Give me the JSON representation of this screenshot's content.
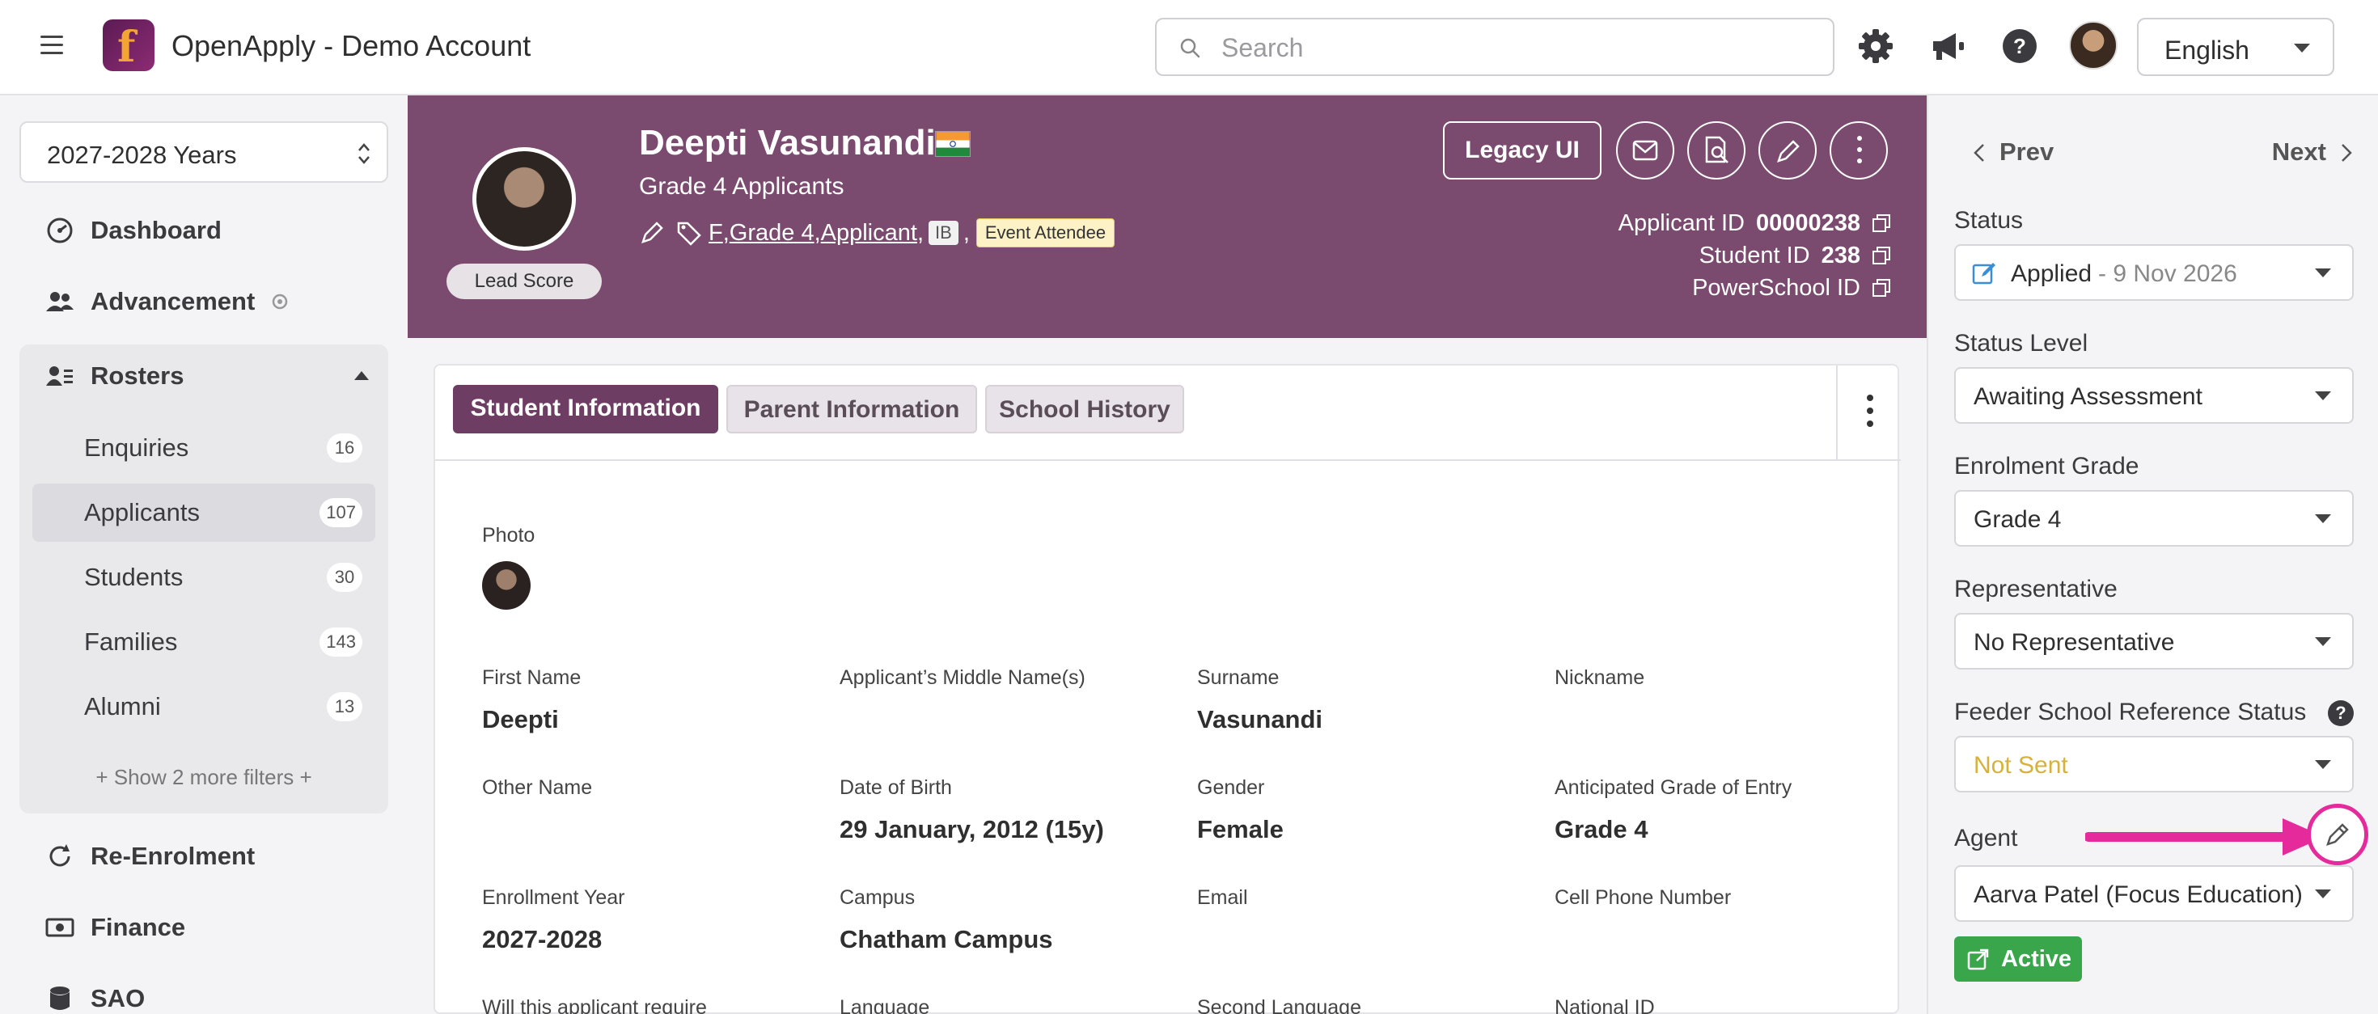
{
  "app": {
    "title": "OpenApply - Demo Account"
  },
  "search": {
    "placeholder": "Search"
  },
  "language": {
    "selected": "English"
  },
  "sidebar": {
    "year": "2027-2028 Years",
    "items": [
      {
        "label": "Dashboard",
        "icon": "dashboard-icon"
      },
      {
        "label": "Advancement",
        "icon": "users-icon"
      },
      {
        "label": "Rosters",
        "icon": "roster-icon"
      },
      {
        "label": "Re-Enrolment",
        "icon": "refresh-icon"
      },
      {
        "label": "Finance",
        "icon": "cash-icon"
      },
      {
        "label": "SAO",
        "icon": "database-icon"
      }
    ],
    "rosters": [
      {
        "label": "Enquiries",
        "count": "16"
      },
      {
        "label": "Applicants",
        "count": "107"
      },
      {
        "label": "Students",
        "count": "30"
      },
      {
        "label": "Families",
        "count": "143"
      },
      {
        "label": "Alumni",
        "count": "13"
      }
    ],
    "more_filters": "+ Show 2 more filters +"
  },
  "applicant": {
    "name": "Deepti Vasunandi",
    "subtitle": "Grade 4 Applicants",
    "lead_score": "Lead Score",
    "tags": {
      "f": "F",
      "grade": "Grade 4",
      "type": "Applicant",
      "ib": "IB",
      "event": "Event Attendee"
    },
    "applicant_id_label": "Applicant ID",
    "applicant_id": "00000238",
    "student_id_label": "Student ID",
    "student_id": "238",
    "powerschool_label": "PowerSchool ID",
    "legacy_label": "Legacy UI"
  },
  "tabs": [
    "Student Information",
    "Parent Information",
    "School History"
  ],
  "fields": {
    "photo": "Photo",
    "first_name": {
      "label": "First Name",
      "value": "Deepti"
    },
    "middle_name": {
      "label": "Applicant’s Middle Name(s)",
      "value": ""
    },
    "surname": {
      "label": "Surname",
      "value": "Vasunandi"
    },
    "nickname": {
      "label": "Nickname",
      "value": ""
    },
    "other_name": {
      "label": "Other Name",
      "value": ""
    },
    "dob": {
      "label": "Date of Birth",
      "value": "29 January, 2012 (15y)"
    },
    "gender": {
      "label": "Gender",
      "value": "Female"
    },
    "anticipated_grade": {
      "label": "Anticipated Grade of Entry",
      "value": "Grade 4"
    },
    "enrollment_year": {
      "label": "Enrollment Year",
      "value": "2027-2028"
    },
    "campus": {
      "label": "Campus",
      "value": "Chatham Campus"
    },
    "email": {
      "label": "Email",
      "value": ""
    },
    "cell_phone": {
      "label": "Cell Phone Number",
      "value": ""
    },
    "require": {
      "label": "Will this applicant require"
    },
    "language": {
      "label": "Language"
    },
    "second_language": {
      "label": "Second Language"
    },
    "national_id": {
      "label": "National ID"
    }
  },
  "panel": {
    "prev": "Prev",
    "next": "Next",
    "status": {
      "label": "Status",
      "value": "Applied",
      "date": " - 9 Nov 2026"
    },
    "status_level": {
      "label": "Status Level",
      "value": "Awaiting Assessment"
    },
    "enrolment_grade": {
      "label": "Enrolment Grade",
      "value": "Grade 4"
    },
    "representative": {
      "label": "Representative",
      "value": "No Representative"
    },
    "feeder": {
      "label": "Feeder School Reference Status",
      "value": "Not Sent"
    },
    "agent": {
      "label": "Agent",
      "value": "Aarva Patel (Focus Education)"
    },
    "active": "Active"
  },
  "colors": {
    "brand_purple": "#7a4a6f",
    "tab_active": "#6e3d63",
    "active_green": "#3aa64b",
    "annotation_pink": "#e52a9b",
    "not_sent": "#d6b23a"
  }
}
